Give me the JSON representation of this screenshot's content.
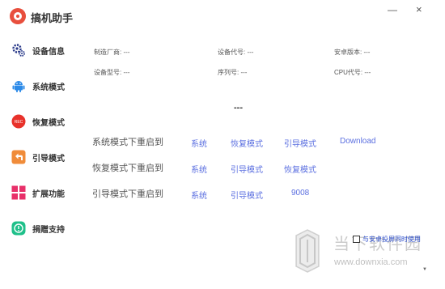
{
  "app": {
    "title": "搞机助手"
  },
  "window": {
    "minimize_icon": "minimize-icon",
    "close_icon": "close-icon"
  },
  "sidebar": {
    "items": [
      {
        "label": "设备信息",
        "icon": "gear-icon"
      },
      {
        "label": "系统模式",
        "icon": "android-icon"
      },
      {
        "label": "恢复模式",
        "icon": "rec-icon",
        "icon_text": "REC"
      },
      {
        "label": "引导模式",
        "icon": "back-arrow-icon"
      },
      {
        "label": "扩展功能",
        "icon": "grid-icon"
      },
      {
        "label": "捐赠支持",
        "icon": "donate-icon"
      }
    ]
  },
  "device_info": {
    "manufacturer": "制造厂商: ---",
    "device_code": "设备代号: ---",
    "android_version": "安卓版本: ---",
    "model": "设备型号: ---",
    "serial": "序列号: ---",
    "cpu_code": "CPU代号: ---"
  },
  "separator": "---",
  "reboot": {
    "rows": [
      {
        "label": "系统模式下重启到",
        "links": [
          "系统",
          "恢复模式",
          "引导模式",
          "Download"
        ]
      },
      {
        "label": "恢复模式下重启到",
        "links": [
          "系统",
          "引导模式",
          "恢复模式"
        ]
      },
      {
        "label": "引导模式下重启到",
        "links": [
          "系统",
          "引导模式",
          "9008"
        ]
      }
    ]
  },
  "screen_mirror": {
    "label": "与安卓投屏同时使用",
    "checked": false
  },
  "watermark": {
    "title": "当下软件园",
    "url": "www.downxia.com"
  },
  "colors": {
    "link": "#5b6fe0",
    "accent_red": "#e84f3d",
    "android_blue": "#2b8ae8",
    "rec_red": "#e8322b",
    "back_orange": "#f08c3a",
    "grid_magenta": "#e8306a",
    "donate_green": "#1fc08a"
  }
}
